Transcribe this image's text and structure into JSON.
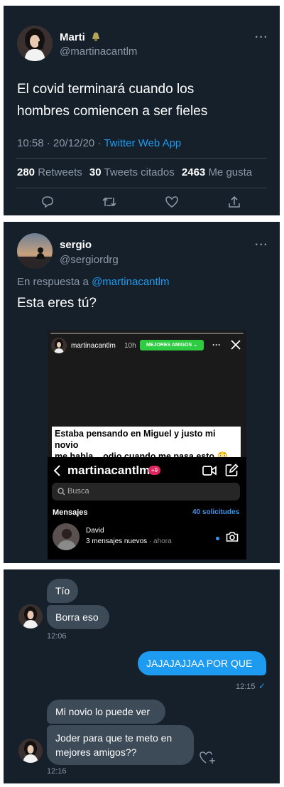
{
  "tweet1": {
    "name": "Marti",
    "handle": "@martinacantlm",
    "text_line1": "El covid terminará cuando los",
    "text_line2": "hombres comiencen a ser fieles",
    "time": "10:58 · 20/12/20 ·",
    "source": "Twitter Web App",
    "retweets_count": "280",
    "retweets_label": "Retweets",
    "quotes_count": "30",
    "quotes_label": "Tweets citados",
    "likes_count": "2463",
    "likes_label": "Me gusta"
  },
  "tweet2": {
    "name": "sergio",
    "handle": "@sergiordrg",
    "reply_prefix": "En respuesta a",
    "reply_to": "@martinacantlm",
    "text": "Esta eres tú?",
    "story": {
      "username": "martinacantlm",
      "age": "10h",
      "best_friends": "MEJORES AMIGOS",
      "caption_line1": "Estaba pensando en Miguel y justo mi novio",
      "caption_line2": "me habla... odio cuando me pasa esto 😳😳",
      "dm_title": "martinacantlm",
      "dm_badge": "+9",
      "search_placeholder": "Busca",
      "messages_label": "Mensajes",
      "requests_label": "40 solicitudes",
      "thread_name": "David",
      "thread_preview": "3 mensajes nuevos",
      "thread_time": "· ahora"
    }
  },
  "chat": {
    "m1": "Tío",
    "m2": "Borra eso",
    "t1": "12:06",
    "m3": "JAJAJAJJAA POR QUE",
    "t2": "12:15",
    "m4": "Mi novio lo puede ver",
    "m5_line1": "Joder para que te meto en",
    "m5_line2": "mejores amigos??",
    "t3": "12:16"
  },
  "colors": {
    "background": "#15202b",
    "accent": "#1d9bf0",
    "muted": "#8b98a5",
    "bubble": "#3d4a57",
    "best_friends_green": "#2ecc40"
  },
  "icons": [
    "bell-emoji-icon",
    "more-icon",
    "reply-icon",
    "retweet-icon",
    "like-icon",
    "share-icon",
    "close-icon",
    "back-icon",
    "video-icon",
    "compose-icon",
    "search-icon",
    "camera-icon",
    "add-like-icon",
    "check-icon"
  ]
}
